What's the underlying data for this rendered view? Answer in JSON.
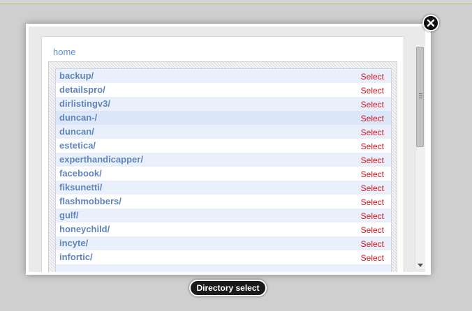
{
  "breadcrumb": {
    "home_label": "home"
  },
  "dialog": {
    "caption": "Directory select"
  },
  "directories": [
    {
      "name": "backup/",
      "action": "Select"
    },
    {
      "name": "detailspro/",
      "action": "Select"
    },
    {
      "name": "dirlistingv3/",
      "action": "Select"
    },
    {
      "name": "duncan-/",
      "action": "Select"
    },
    {
      "name": "duncan/",
      "action": "Select"
    },
    {
      "name": "estetica/",
      "action": "Select"
    },
    {
      "name": "experthandicapper/",
      "action": "Select"
    },
    {
      "name": "facebook/",
      "action": "Select"
    },
    {
      "name": "fiksunetti/",
      "action": "Select"
    },
    {
      "name": "flashmobbers/",
      "action": "Select"
    },
    {
      "name": "gulf/",
      "action": "Select"
    },
    {
      "name": "honeychild/",
      "action": "Select"
    },
    {
      "name": "incyte/",
      "action": "Select"
    },
    {
      "name": "infortic/",
      "action": "Select"
    },
    {
      "name": "",
      "action": ""
    }
  ],
  "colors": {
    "link_blue": "#5f85bb",
    "select_red": "#d2141c",
    "row_alt": "#e9f0fb"
  }
}
